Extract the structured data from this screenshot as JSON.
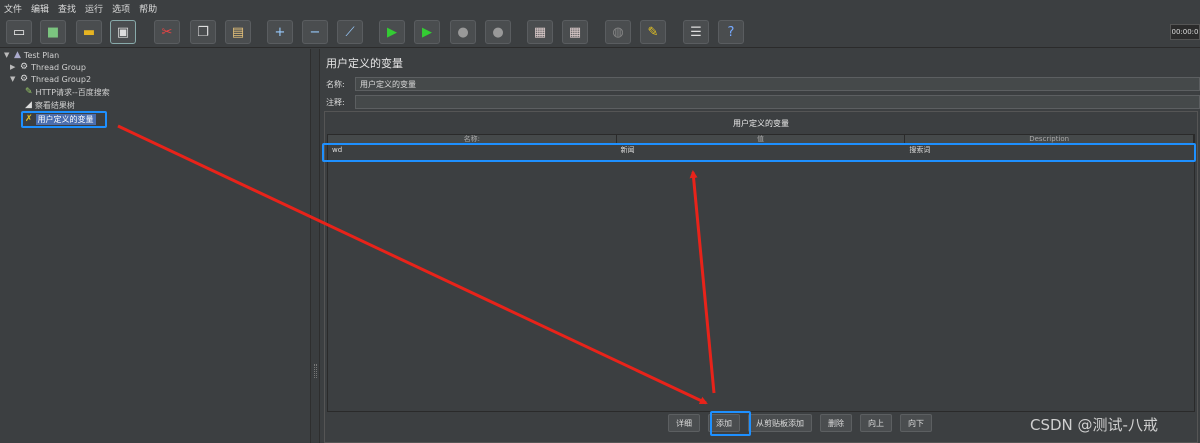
{
  "menu": [
    "文件",
    "编辑",
    "查找",
    "运行",
    "选项",
    "帮助"
  ],
  "toolbar": {
    "icons": [
      "new-icon",
      "templates-icon",
      "open-icon",
      "save-icon",
      "cut-icon",
      "copy-icon",
      "paste-icon",
      "expand-icon",
      "collapse-icon",
      "toggle-icon",
      "start-icon",
      "start-no-pause-icon",
      "stop-icon",
      "shutdown-icon",
      "clear-icon",
      "clear-all-icon",
      "search-icon",
      "reset-search-icon",
      "function-helper-icon",
      "help-icon"
    ],
    "timer": "00:00:0"
  },
  "tree": {
    "nodes": [
      {
        "label": "Test Plan",
        "icon": "test-plan-icon"
      },
      {
        "label": "Thread Group",
        "icon": "thread-group-icon"
      },
      {
        "label": "Thread Group2",
        "icon": "thread-group-icon"
      },
      {
        "label": "HTTP请求--百度搜索",
        "icon": "http-sampler-icon"
      },
      {
        "label": "察看结果树",
        "icon": "listener-icon"
      },
      {
        "label": "用户定义的变量",
        "icon": "config-icon"
      }
    ]
  },
  "main": {
    "title": "用户定义的变量",
    "name_label": "名称:",
    "name_value": "用户定义的变量",
    "comment_label": "注释:",
    "comment_value": "",
    "panel_title": "用户定义的变量",
    "columns": [
      "名称:",
      "值",
      "Description"
    ],
    "rows": [
      {
        "name": "wd",
        "value": "新闻",
        "description": "搜索词"
      }
    ],
    "buttons": [
      "详细",
      "添加",
      "从剪贴板添加",
      "删除",
      "向上",
      "向下"
    ]
  },
  "watermark": "CSDN @测试-八戒",
  "colors": {
    "highlight": "#1e90ff",
    "arrow": "#e8231a",
    "selection": "#4b6eaf"
  }
}
